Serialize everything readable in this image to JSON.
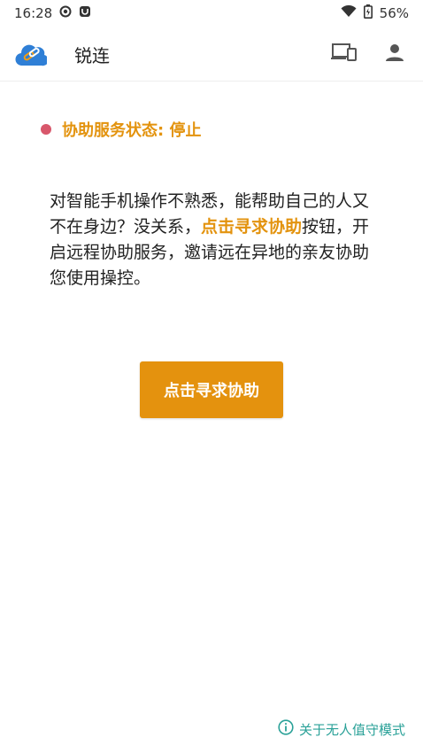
{
  "status_bar": {
    "time": "16:28",
    "battery_percent": "56%",
    "icons": [
      "record-icon",
      "app-notification-icon",
      "wifi-icon",
      "battery-icon"
    ]
  },
  "app_bar": {
    "title": "锐连",
    "logo_icon": "cloud-link-icon",
    "actions": [
      "devices-icon",
      "person-icon"
    ]
  },
  "service_status": {
    "label": "协助服务状态: 停止",
    "dot_color": "#d8576b"
  },
  "description": {
    "part1": "对智能手机操作不熟悉，能帮助自己的人又不在身边？没关系，",
    "highlight": "点击寻求协助",
    "part2": "按钮，开启远程协助服务，邀请远在异地的亲友协助您使用操控。"
  },
  "help_button": {
    "label": "点击寻求协助"
  },
  "footer": {
    "unattended_link": "关于无人值守模式",
    "icon": "info-icon"
  },
  "colors": {
    "accent": "#e4920e",
    "teal": "#2aa198"
  }
}
